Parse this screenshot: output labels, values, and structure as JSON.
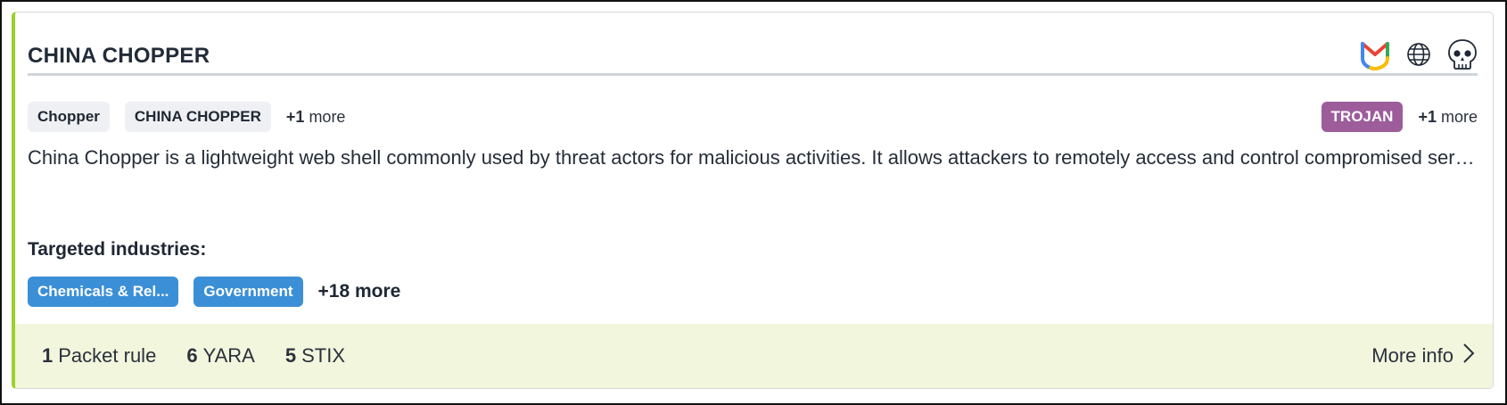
{
  "card": {
    "title": "CHINA CHOPPER",
    "icons": [
      "gmail-icon",
      "globe-icon",
      "skull-icon"
    ],
    "aliases": [
      "Chopper",
      "CHINA CHOPPER"
    ],
    "aliases_more_count": "+1",
    "aliases_more_label": "more",
    "types": [
      "TROJAN"
    ],
    "types_more_count": "+1",
    "types_more_label": "more",
    "description": "China Chopper is a lightweight web shell commonly used by threat actors for malicious activities. It allows attackers to remotely access and control compromised servers",
    "industries_label": "Targeted industries:",
    "industries": [
      "Chemicals & Rel...",
      "Government"
    ],
    "industries_more": "+18 more"
  },
  "footer": {
    "stats": [
      {
        "count": "1",
        "label": "Packet rule"
      },
      {
        "count": "6",
        "label": "YARA"
      },
      {
        "count": "5",
        "label": "STIX"
      }
    ],
    "more_info_label": "More info"
  },
  "colors": {
    "accent_left_border": "#9bd12b",
    "trojan_badge": "#9c5d9a",
    "industry_chip": "#3b8fd6",
    "footer_background": "#f2f6dd"
  }
}
